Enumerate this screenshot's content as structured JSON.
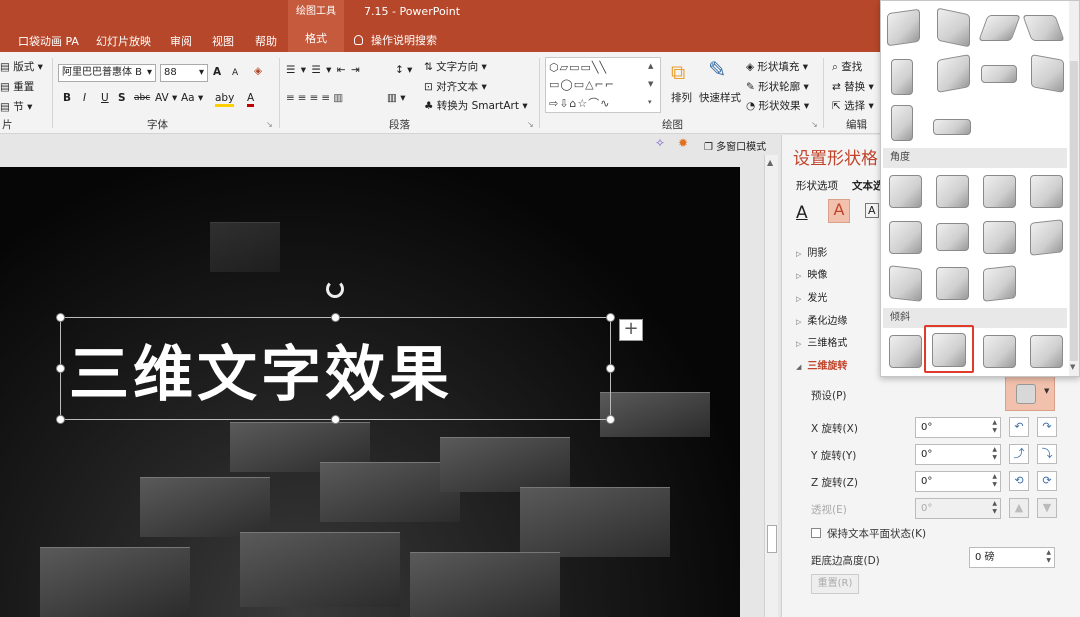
{
  "titlebar": {
    "context_tool": "绘图工具",
    "document_title": "7.15 - PowerPoint"
  },
  "tabs": {
    "items": [
      "口袋动画 PA",
      "幻灯片放映",
      "审阅",
      "视图",
      "帮助",
      "格式"
    ],
    "tell_me": "操作说明搜索"
  },
  "ribbon": {
    "slides_group": {
      "layout": "版式",
      "reset": "重置",
      "section": "节",
      "label": "片"
    },
    "font_group": {
      "font_name": "阿里巴巴普惠体 B",
      "font_size": "88",
      "grow": "A",
      "shrink": "A",
      "bold": "B",
      "italic": "I",
      "underline": "U",
      "shadow": "S",
      "strike": "abc",
      "spacing": "AV",
      "case": "Aa",
      "highlight": "aby",
      "font_color": "A",
      "label": "字体"
    },
    "paragraph_group": {
      "text_direction": "文字方向",
      "align_text": "对齐文本",
      "convert_smartart": "转换为 SmartArt",
      "label": "段落"
    },
    "drawing_group": {
      "arrange": "排列",
      "quick_styles": "快速样式",
      "shape_fill": "形状填充",
      "shape_outline": "形状轮廓",
      "shape_effects": "形状效果",
      "label": "绘图"
    },
    "editing_group": {
      "find": "查找",
      "replace": "替换",
      "select": "选择",
      "label": "编辑"
    }
  },
  "slide_toolbar": {
    "multi_window": "多窗口模式"
  },
  "slide": {
    "title_text": "三维文字效果"
  },
  "pane": {
    "title": "设置形状格",
    "tabs": [
      "形状选项",
      "文本选"
    ],
    "text_icons": [
      "A",
      "A",
      "A"
    ],
    "sections": [
      "阴影",
      "映像",
      "发光",
      "柔化边缘",
      "三维格式",
      "三维旋转"
    ],
    "preset_label": "预设(P)",
    "x_rotation": {
      "label": "X 旋转(X)",
      "value": "0°"
    },
    "y_rotation": {
      "label": "Y 旋转(Y)",
      "value": "0°"
    },
    "z_rotation": {
      "label": "Z 旋转(Z)",
      "value": "0°"
    },
    "perspective": {
      "label": "透视(E)",
      "value": "0°"
    },
    "keep_text_flat": "保持文本平面状态(K)",
    "distance_label": "距底边高度(D)",
    "distance_value": "0 磅",
    "reset_button": "重置(R)"
  },
  "gallery": {
    "headings": [
      "角度",
      "倾斜"
    ],
    "selected_section": "倾斜",
    "selected_index": 1
  }
}
